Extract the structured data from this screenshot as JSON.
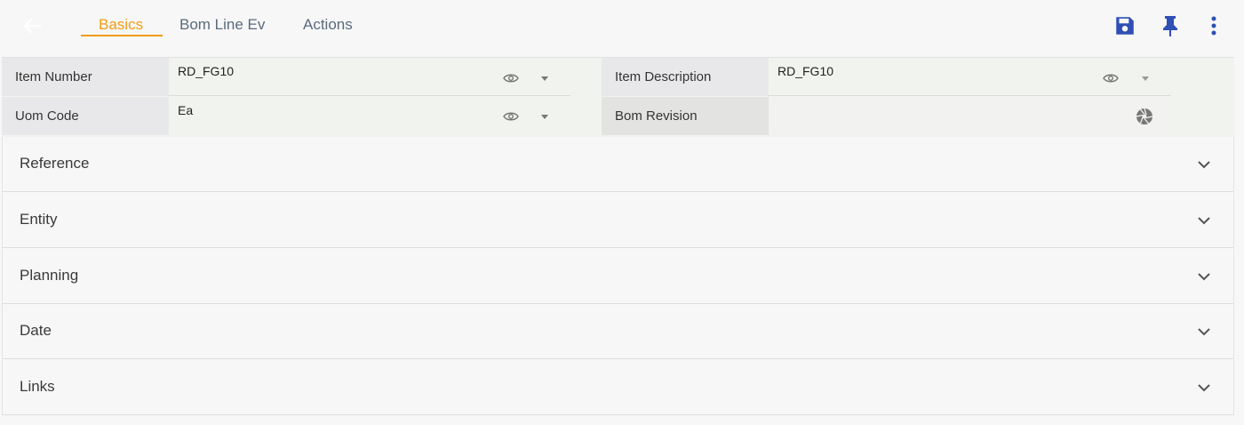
{
  "header": {
    "back_icon": "arrow-left-icon",
    "tabs": [
      {
        "label": "Basics",
        "active": true
      },
      {
        "label": "Bom Line Ev",
        "active": false
      },
      {
        "label": "Actions",
        "active": false
      }
    ],
    "actions": {
      "save_icon": "save-icon",
      "pin_icon": "pin-icon",
      "more_icon": "more-vertical-icon"
    },
    "accent_color": "#f39c12",
    "action_color": "#2f4fb5"
  },
  "form": {
    "item_number": {
      "label": "Item Number",
      "value": "RD_FG10"
    },
    "item_description": {
      "label": "Item Description",
      "value": "RD_FG10"
    },
    "uom_code": {
      "label": "Uom Code",
      "value": "Ea"
    },
    "bom_revision": {
      "label": "Bom Revision",
      "value": ""
    }
  },
  "sections": [
    {
      "title": "Reference"
    },
    {
      "title": "Entity"
    },
    {
      "title": "Planning"
    },
    {
      "title": "Date"
    },
    {
      "title": "Links"
    }
  ]
}
